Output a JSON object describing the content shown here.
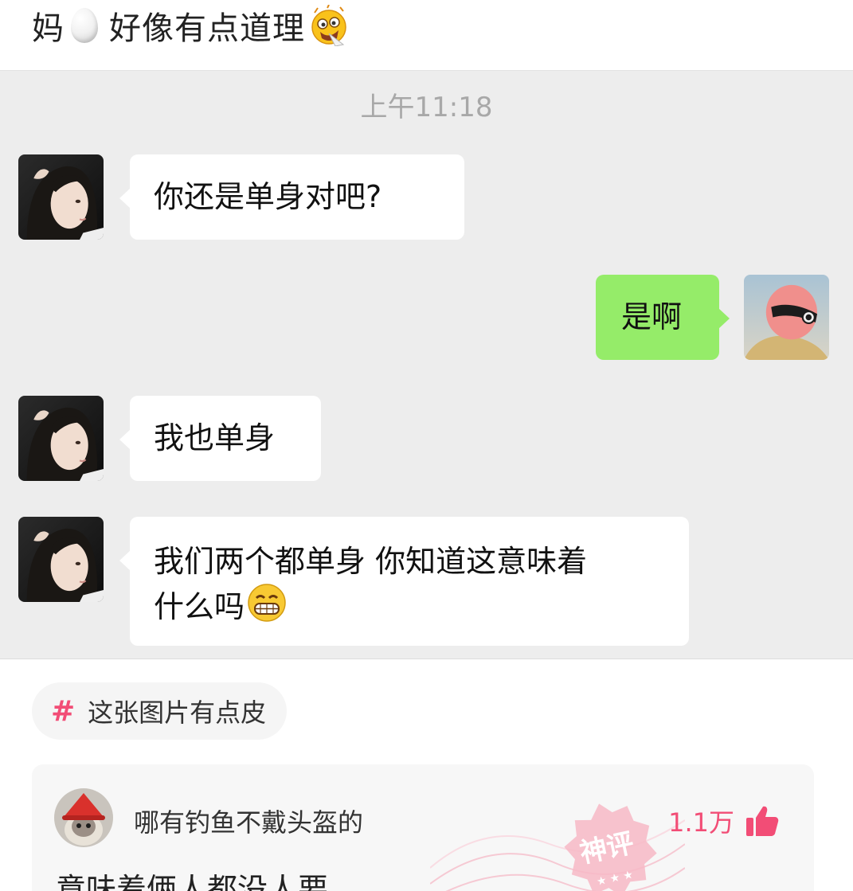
{
  "post": {
    "title_part1": "妈",
    "title_part2": "好像有点道理",
    "icons": [
      "egg-icon",
      "crazy-face-emoji"
    ]
  },
  "chat": {
    "timestamp": "上午11:18",
    "messages": [
      {
        "side": "left",
        "text": "你还是单身对吧?"
      },
      {
        "side": "right",
        "text": "是啊"
      },
      {
        "side": "left",
        "text": "我也单身"
      },
      {
        "side": "left",
        "line1": "我们两个都单身 你知道这意味着",
        "line2": "什么吗",
        "emoji": "grinning-face-emoji"
      }
    ],
    "colors": {
      "background": "#ededed",
      "sent_bubble": "#95ec69",
      "received_bubble": "#ffffff"
    }
  },
  "topic": {
    "label": "这张图片有点皮",
    "icon": "hashtag-icon"
  },
  "comment": {
    "username": "哪有钓鱼不戴头盔的",
    "likes": "1.1万",
    "badge": "神评",
    "text": "意味着俩人都没人要",
    "icons": [
      "thumb-up-icon"
    ],
    "accent_color": "#f24d76"
  }
}
